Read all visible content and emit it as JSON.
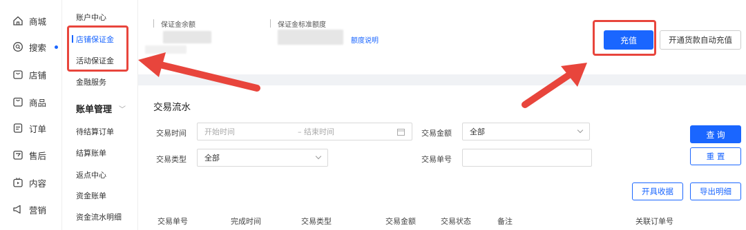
{
  "nav": {
    "items": [
      {
        "label": "商城",
        "icon": "home-icon"
      },
      {
        "label": "搜索",
        "icon": "search-circle-icon",
        "dot": true
      },
      {
        "label": "店铺",
        "icon": "shop-icon"
      },
      {
        "label": "商品",
        "icon": "goods-icon"
      },
      {
        "label": "订单",
        "icon": "order-icon"
      },
      {
        "label": "售后",
        "icon": "after-sale-icon"
      },
      {
        "label": "内容",
        "icon": "content-icon"
      },
      {
        "label": "营销",
        "icon": "marketing-icon"
      }
    ]
  },
  "subnav": {
    "account_center": "账户中心",
    "shop_deposit": "店铺保证金",
    "activity_deposit": "活动保证金",
    "finance_service": "金融服务",
    "billing_group": "账单管理",
    "pending_orders": "待结算订单",
    "settled_bills": "结算账单",
    "rebate_center": "返点中心",
    "fund_bills": "资金账单",
    "fund_flow": "资金流水明细"
  },
  "deposit": {
    "balance_label": "保证金余额",
    "standard_label": "保证金标准额度",
    "quota_link": "额度说明",
    "recharge_button": "充值",
    "auto_recharge_button": "开通货款自动充值"
  },
  "transactions": {
    "title": "交易流水",
    "time_label": "交易时间",
    "start_placeholder": "开始时间",
    "end_placeholder": "– 结束时间",
    "amount_label": "交易金额",
    "amount_value": "全部",
    "type_label": "交易类型",
    "type_value": "全部",
    "order_no_label": "交易单号",
    "query_button": "查 询",
    "reset_button": "重 置",
    "receipt_button": "开具收据",
    "export_button": "导出明细",
    "columns": [
      "交易单号",
      "完成时间",
      "交易类型",
      "交易金额",
      "交易状态",
      "备注",
      "关联订单号"
    ]
  },
  "colors": {
    "accent": "#1a66ff",
    "annotation": "#e8453c"
  }
}
